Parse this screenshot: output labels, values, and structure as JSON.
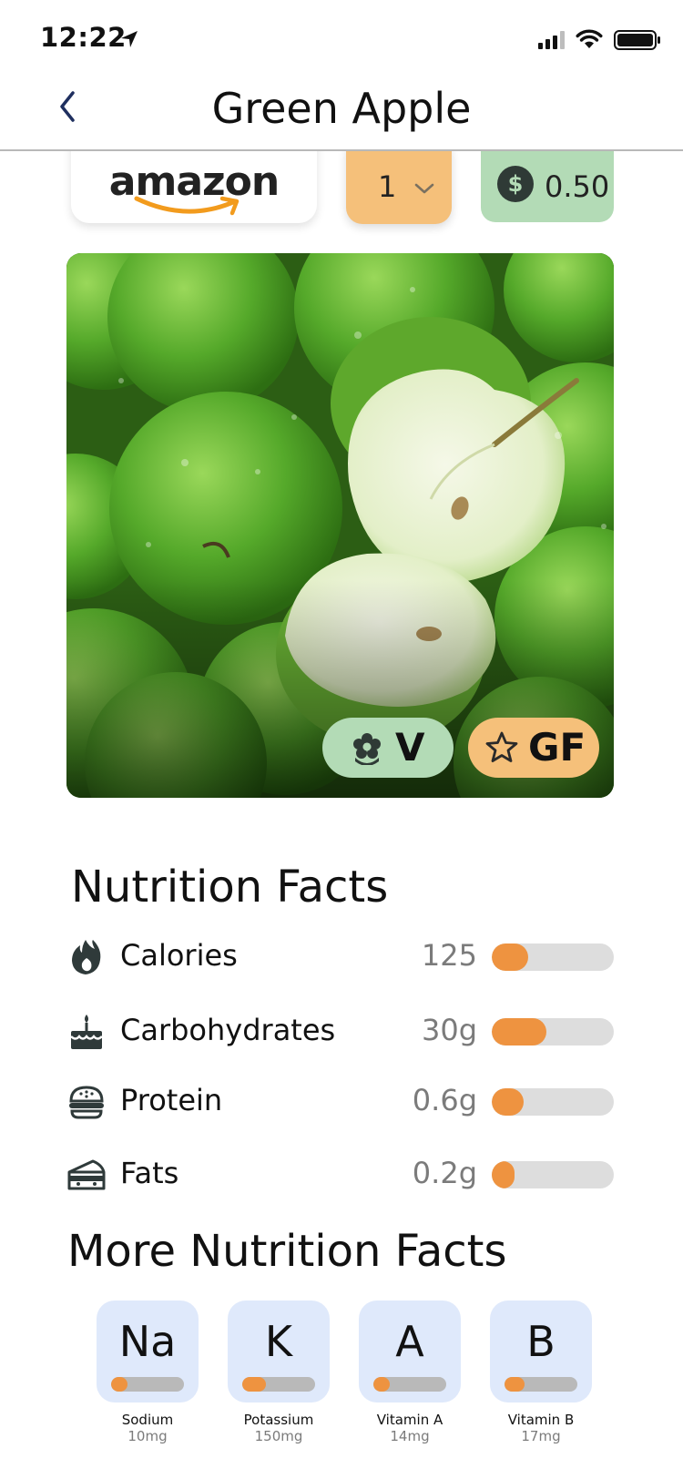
{
  "status_bar": {
    "time": "12:22",
    "icons": [
      "location-arrow-icon",
      "cellular-signal-icon",
      "wifi-icon",
      "battery-icon"
    ]
  },
  "nav": {
    "back_icon": "chevron-left-icon",
    "title": "Green Apple"
  },
  "store": {
    "name": "amazon",
    "logo_icon": "amazon-smile-icon"
  },
  "quantity": {
    "selected": "1",
    "icon": "chevron-down-icon"
  },
  "price": {
    "currency_icon": "dollar-icon",
    "value": "0.50"
  },
  "hero_image": {
    "subject": "green-apples-photo"
  },
  "diet_badges": [
    {
      "label": "V",
      "icon": "flower-icon",
      "color": "#b3dbb6"
    },
    {
      "label": "GF",
      "icon": "star-outline-icon",
      "color": "#f5c07a"
    }
  ],
  "nutrition": {
    "title": "Nutrition Facts",
    "items": [
      {
        "label": "Calories",
        "value": "125",
        "icon": "flame-icon",
        "level": 0.3
      },
      {
        "label": "Carbohydrates",
        "value": "30g",
        "icon": "cake-icon",
        "level": 0.45
      },
      {
        "label": "Protein",
        "value": "0.6g",
        "icon": "burger-icon",
        "level": 0.26
      },
      {
        "label": "Fats",
        "value": "0.2g",
        "icon": "cheese-icon",
        "level": 0.19
      }
    ]
  },
  "more_nutrition": {
    "title": "More Nutrition Facts",
    "items": [
      {
        "symbol": "Na",
        "name": "Sodium",
        "amount": "10mg",
        "level": 0.22
      },
      {
        "symbol": "K",
        "name": "Potassium",
        "amount": "150mg",
        "level": 0.32
      },
      {
        "symbol": "A",
        "name": "Vitamin A",
        "amount": "14mg",
        "level": 0.22
      },
      {
        "symbol": "B",
        "name": "Vitamin B",
        "amount": "17mg",
        "level": 0.28
      }
    ]
  },
  "colors": {
    "accent_orange": "#ee9340",
    "badge_green": "#b3dbb6",
    "badge_orange": "#f5c07a",
    "mineral_card": "#dfe9fb"
  }
}
